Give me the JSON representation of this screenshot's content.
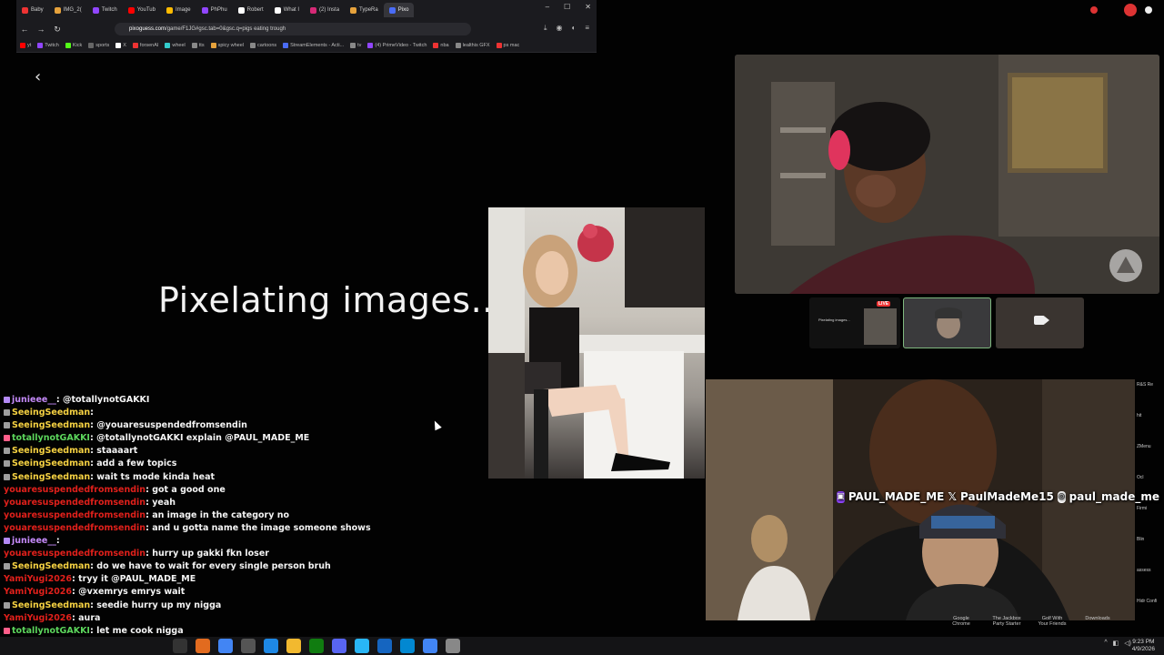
{
  "browser": {
    "tabs": [
      {
        "label": "Baby",
        "color": "#e33"
      },
      {
        "label": "IMG_2(",
        "color": "#e6a23c"
      },
      {
        "label": "Twitch",
        "color": "#9146ff"
      },
      {
        "label": "YouTub",
        "color": "#f00"
      },
      {
        "label": "Image",
        "color": "#fb0"
      },
      {
        "label": "PhPhu",
        "color": "#9146ff"
      },
      {
        "label": "Robert",
        "color": "#fff"
      },
      {
        "label": "What I",
        "color": "#fff"
      },
      {
        "label": "(2) Insta",
        "color": "#d62976"
      },
      {
        "label": "TypeRa",
        "color": "#e6a23c"
      },
      {
        "label": "Pixo",
        "color": "#4a6cf7"
      }
    ],
    "url_host": "pixoguess.com",
    "url_path": "/game/F1JG#gsc.tab=0&gsc.q=pigs eating trough",
    "bookmarks": [
      {
        "label": "yt",
        "color": "#f00"
      },
      {
        "label": "Twitch",
        "color": "#9146ff"
      },
      {
        "label": "Kick",
        "color": "#53fc18"
      },
      {
        "label": "sports",
        "color": "#666"
      },
      {
        "label": "X",
        "color": "#fff"
      },
      {
        "label": "forsenAI",
        "color": "#e33"
      },
      {
        "label": "wheel",
        "color": "#3cc"
      },
      {
        "label": "tts",
        "color": "#888"
      },
      {
        "label": "spicy wheel",
        "color": "#e6a23c"
      },
      {
        "label": "cartoons",
        "color": "#888"
      },
      {
        "label": "StreamElements - Acti...",
        "color": "#4a6cf7"
      },
      {
        "label": "tv",
        "color": "#888"
      },
      {
        "label": "(4) PrimeVideo - Twitch",
        "color": "#9146ff"
      },
      {
        "label": "nba",
        "color": "#e33"
      },
      {
        "label": "lealthis GFX",
        "color": "#888"
      },
      {
        "label": "ps mac",
        "color": "#e33"
      }
    ]
  },
  "page": {
    "back_icon": "chevron-left-icon",
    "loading_text": "Pixelating images..."
  },
  "social": {
    "twitch": "PAUL_MADE_ME",
    "x": "PaulMadeMe15",
    "instagram": "paul_made_me"
  },
  "thumbs": {
    "live_badge": "LIVE",
    "thumb1_text": "Pixelating images..."
  },
  "chat": [
    {
      "user": "junieee__",
      "msg": "@totallynotGAKKI",
      "color": "#c58af9",
      "badge": "#b48af7"
    },
    {
      "user": "SeeingSeedman",
      "msg": "",
      "color": "#f5d142",
      "badge": "#9e9e9e"
    },
    {
      "user": "SeeingSeedman",
      "msg": "@youaresuspendedfromsendin",
      "color": "#f5d142",
      "badge": "#9e9e9e"
    },
    {
      "user": "totallynotGAKKI",
      "msg": "@totallynotGAKKI explain @PAUL_MADE_ME",
      "color": "#5cd65c",
      "badge": "#ff5e8a"
    },
    {
      "user": "SeeingSeedman",
      "msg": "staaaart",
      "color": "#f5d142",
      "badge": "#9e9e9e"
    },
    {
      "user": "SeeingSeedman",
      "msg": "add a few topics",
      "color": "#f5d142",
      "badge": "#9e9e9e"
    },
    {
      "user": "SeeingSeedman",
      "msg": "wait ts mode kinda heat",
      "color": "#f5d142",
      "badge": "#9e9e9e"
    },
    {
      "user": "youaresuspendedfromsendin",
      "msg": "got a good one",
      "color": "#e0201b",
      "badge": ""
    },
    {
      "user": "youaresuspendedfromsendin",
      "msg": "yeah",
      "color": "#e0201b",
      "badge": ""
    },
    {
      "user": "youaresuspendedfromsendin",
      "msg": "an image in the category no",
      "color": "#e0201b",
      "badge": ""
    },
    {
      "user": "youaresuspendedfromsendin",
      "msg": "and u gotta name the image someone shows",
      "color": "#e0201b",
      "badge": ""
    },
    {
      "user": "junieee__",
      "msg": "",
      "color": "#c58af9",
      "badge": "#b48af7"
    },
    {
      "user": "youaresuspendedfromsendin",
      "msg": "hurry up gakki fkn loser",
      "color": "#e0201b",
      "badge": ""
    },
    {
      "user": "SeeingSeedman",
      "msg": "do we have to wait for every single person bruh",
      "color": "#f5d142",
      "badge": "#9e9e9e"
    },
    {
      "user": "YamiYugi2026",
      "msg": "tryy it @PAUL_MADE_ME",
      "color": "#e0201b",
      "badge": ""
    },
    {
      "user": "YamiYugi2026",
      "msg": "@vxemrys emrys wait",
      "color": "#e0201b",
      "badge": ""
    },
    {
      "user": "SeeingSeedman",
      "msg": "seedie hurry up my nigga",
      "color": "#f5d142",
      "badge": "#9e9e9e"
    },
    {
      "user": "YamiYugi2026",
      "msg": "aura",
      "color": "#e0201b",
      "badge": ""
    },
    {
      "user": "totallynotGAKKI",
      "msg": "let me cook nigga",
      "color": "#5cd65c",
      "badge": "#ff5e8a"
    }
  ],
  "desktop": {
    "labels": [
      "Google Chrome",
      "The Jackbox Party Starter",
      "Golf With Your Friends",
      "Downloads"
    ],
    "right_labels": [
      "R&S Re",
      "hit",
      "ZMenu",
      "Ocl",
      "Firmi",
      "Blin",
      "assess",
      "Hidr Confi"
    ]
  },
  "taskbar": {
    "time": "9:23 PM",
    "date": "4/9/2026"
  }
}
